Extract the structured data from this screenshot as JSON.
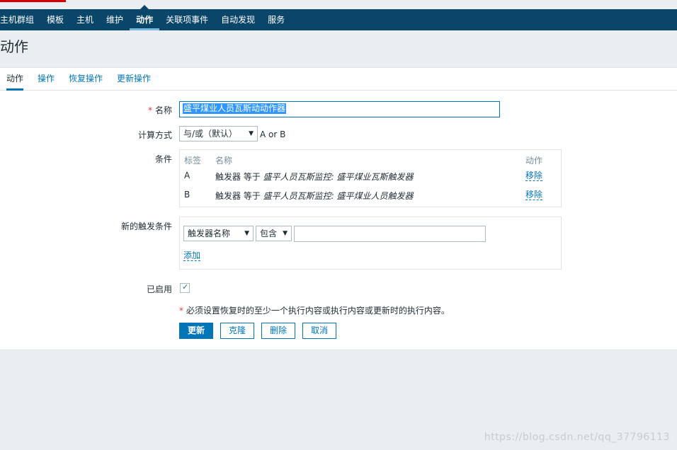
{
  "nav": {
    "items": [
      {
        "label": "主机群组",
        "active": false
      },
      {
        "label": "模板",
        "active": false
      },
      {
        "label": "主机",
        "active": false
      },
      {
        "label": "维护",
        "active": false
      },
      {
        "label": "动作",
        "active": true
      },
      {
        "label": "关联项事件",
        "active": false
      },
      {
        "label": "自动发现",
        "active": false
      },
      {
        "label": "服务",
        "active": false
      }
    ]
  },
  "page_title": "动作",
  "tabs": [
    {
      "label": "动作",
      "active": true
    },
    {
      "label": "操作",
      "active": false
    },
    {
      "label": "恢复操作",
      "active": false
    },
    {
      "label": "更新操作",
      "active": false
    }
  ],
  "form": {
    "name_required": "*",
    "name_label": "名称",
    "name_value": "盛平煤业人员瓦斯动动作器",
    "calc_label": "计算方式",
    "calc_value": "与/或（默认）",
    "calc_expression": "A or B",
    "conditions_label": "条件",
    "conditions": {
      "headers": {
        "tag": "标签",
        "name": "名称",
        "action": "动作"
      },
      "rows": [
        {
          "tag": "A",
          "prefix": "触发器 等于 ",
          "italic": "盛平人员瓦斯监控: 盛平煤业瓦斯触发器",
          "action": "移除"
        },
        {
          "tag": "B",
          "prefix": "触发器 等于 ",
          "italic": "盛平人员瓦斯监控: 盛平煤业人员触发器",
          "action": "移除"
        }
      ]
    },
    "new_condition_label": "新的触发条件",
    "new_condition": {
      "type_value": "触发器名称",
      "operator_value": "包含",
      "value": "",
      "add_label": "添加"
    },
    "enabled_label": "已启用",
    "enabled": true,
    "note_star": "*",
    "note": " 必须设置恢复时的至少一个执行内容或执行内容或更新时的执行内容。",
    "buttons": {
      "update": "更新",
      "clone": "克隆",
      "delete": "删除",
      "cancel": "取消"
    }
  },
  "watermark": "https://blog.csdn.net/qq_37796113",
  "colors": {
    "nav_bg": "#0a466a",
    "accent": "#0275b8",
    "required": "#e33734"
  }
}
